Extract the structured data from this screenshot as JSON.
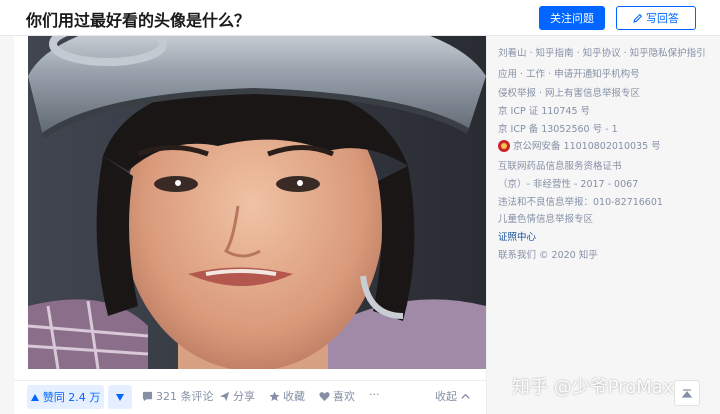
{
  "header": {
    "question_title": "你们用过最好看的头像是什么？",
    "follow_label": "关注问题",
    "write_label": "写回答"
  },
  "actions": {
    "vote_up_label": "赞同 2.4 万",
    "comments_label": "321 条评论",
    "share_label": "分享",
    "favorite_label": "收藏",
    "like_label": "喜欢",
    "more_label": "···",
    "collapse_label": "收起"
  },
  "sidebar": {
    "lines": [
      "刘看山 · 知乎指南 · 知乎协议 · 知乎隐私保护指引",
      "应用 · 工作 · 申请开通知乎机构号",
      "侵权举报 · 网上有害信息举报专区",
      "京 ICP 证 110745 号",
      "京 ICP 备 13052560 号 - 1",
      "京公网安备 11010802010035 号",
      "互联网药品信息服务资格证书",
      "（京）- 非经营性 - 2017 - 0067",
      "违法和不良信息举报：010-82716601",
      "儿童色情信息举报专区",
      "证照中心",
      "联系我们 © 2020 知乎"
    ]
  },
  "watermark": "知乎 @少爷ProMax",
  "colors": {
    "accent": "#0066ff",
    "muted": "#8590a6",
    "link": "#175199"
  }
}
